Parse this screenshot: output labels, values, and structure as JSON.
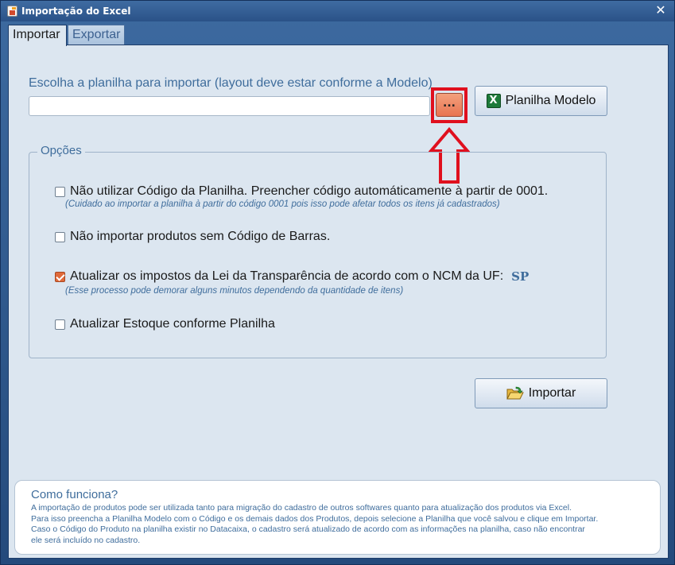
{
  "window": {
    "title": "Importação do Excel",
    "close_glyph": "✕"
  },
  "tabs": [
    {
      "label": "Importar",
      "active": true
    },
    {
      "label": "Exportar",
      "active": false
    }
  ],
  "file_picker": {
    "label": "Escolha a planilha para importar (layout deve estar conforme a Modelo)",
    "value": "",
    "browse_label": "...",
    "model_button_label": "Planilha Modelo",
    "model_icon": "excel-icon"
  },
  "options": {
    "legend": "Opções",
    "items": [
      {
        "label": "Não utilizar Código da Planilha. Preencher código automáticamente à partir de 0001.",
        "hint": "(Cuidado ao importar a planilha à partir do código 0001 pois isso pode afetar todos os itens já cadastrados)",
        "checked": false
      },
      {
        "label": "Não importar produtos sem Código de Barras.",
        "hint": "",
        "checked": false
      },
      {
        "label": "Atualizar os impostos da Lei da Transparência de acordo com o NCM da UF:",
        "hint": "(Esse processo pode demorar alguns minutos dependendo da quantidade de itens)",
        "checked": true,
        "uf": "SP"
      },
      {
        "label": "Atualizar Estoque conforme Planilha",
        "hint": "",
        "checked": false
      }
    ]
  },
  "import_button": {
    "label": "Importar",
    "icon": "folder-open-icon"
  },
  "info": {
    "title": "Como funciona?",
    "lines": [
      "A importação de produtos pode ser utilizada tanto para migração do cadastro de outros softwares quanto para atualização dos produtos via Excel.",
      "Para isso preencha a Planilha Modelo com o Código e os demais dados dos Produtos, depois selecione a Planilha que você salvou e clique em Importar.",
      "Caso o Código do Produto na planilha existir no Datacaixa, o cadastro será atualizado de acordo com as informações na planilha, caso não encontrar",
      "ele será incluído no cadastro."
    ]
  },
  "colors": {
    "accent_text": "#3f6d9c",
    "highlight": "#e0101e",
    "checkbox_checked": "#e06a3a"
  }
}
